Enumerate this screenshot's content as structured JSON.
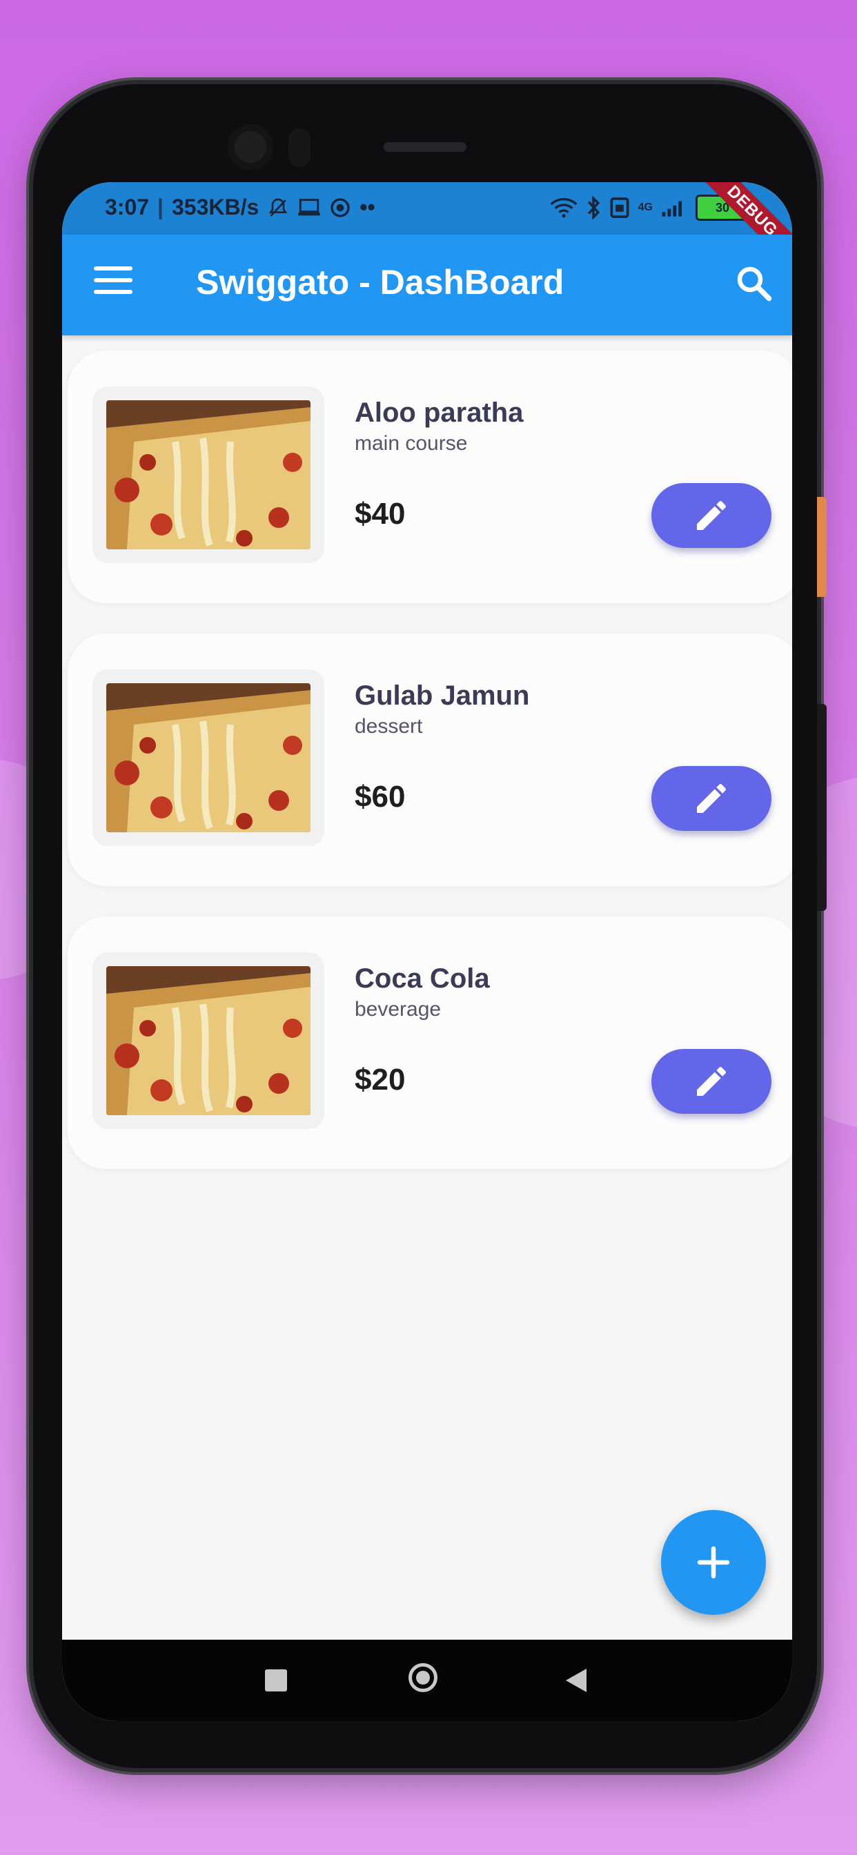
{
  "status_bar": {
    "time": "3:07",
    "net_speed": "353KB/s",
    "network_label": "4G",
    "battery": "30"
  },
  "debug_banner": "DEBUG",
  "app_bar": {
    "title": "Swiggato - DashBoard"
  },
  "items": [
    {
      "name": "Aloo paratha",
      "category": "main course",
      "price": "$40"
    },
    {
      "name": "Gulab Jamun",
      "category": "dessert",
      "price": "$60"
    },
    {
      "name": "Coca Cola",
      "category": "beverage",
      "price": "$20"
    }
  ],
  "colors": {
    "app_bar": "#2196f3",
    "edit_button": "#6366e8",
    "fab": "#2196f3",
    "background": "#cc68e4"
  },
  "icons": {
    "menu": "menu-icon",
    "search": "search-icon",
    "edit": "pencil-icon",
    "add": "plus-icon"
  }
}
